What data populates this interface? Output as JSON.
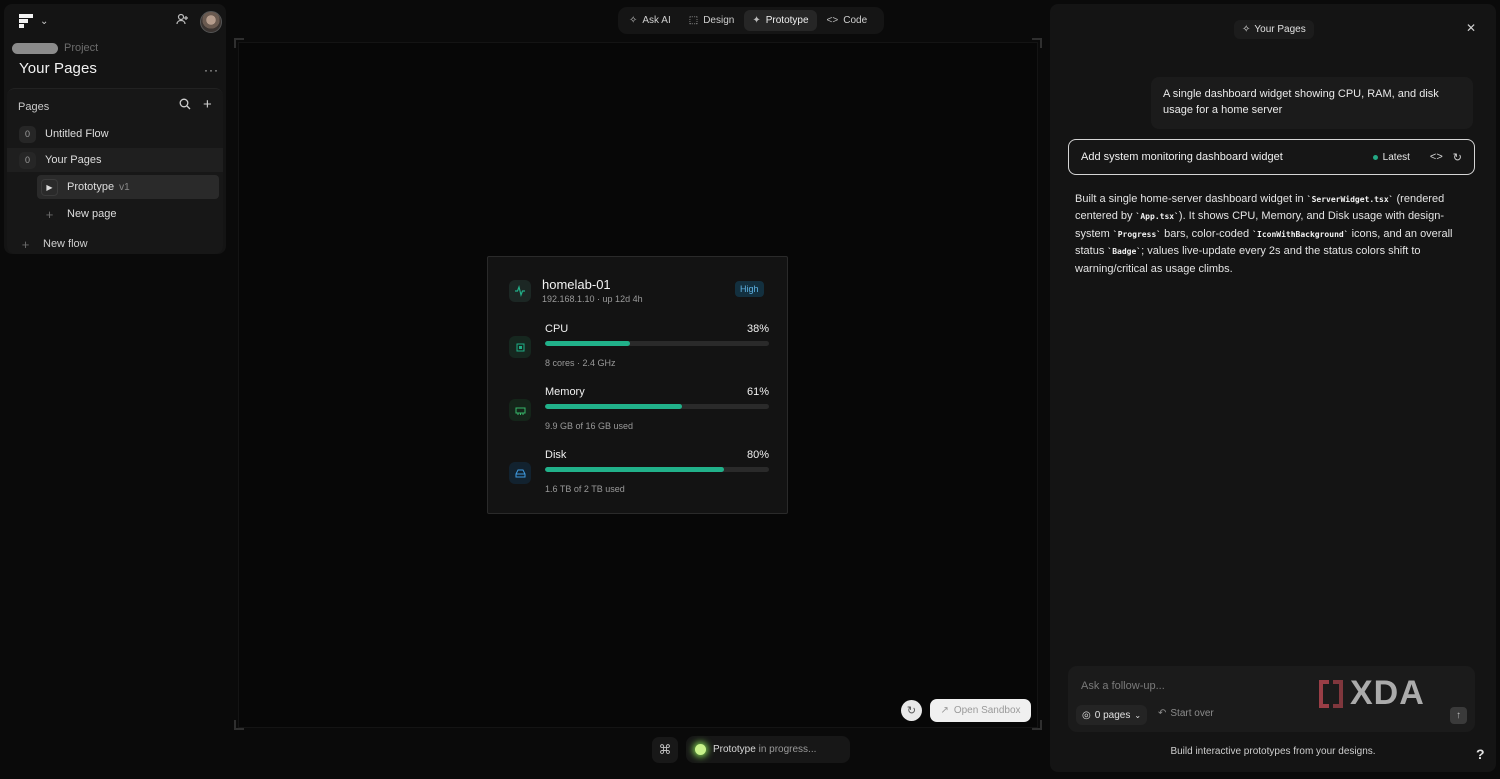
{
  "project": {
    "crumb_label": "Project",
    "title": "Your Pages",
    "more": "···"
  },
  "pages_panel": {
    "heading": "Pages",
    "items": [
      {
        "badge": "0",
        "label": "Untitled Flow"
      },
      {
        "badge": "0",
        "label": "Your Pages"
      }
    ],
    "sub_items": [
      {
        "label": "Prototype",
        "version": "v1"
      },
      {
        "label": "New page"
      }
    ],
    "new_flow": "New flow"
  },
  "modes": [
    {
      "icon": "sparkle-icon",
      "glyph": "✧",
      "label": "Ask AI"
    },
    {
      "icon": "design-icon",
      "glyph": "⬚",
      "label": "Design"
    },
    {
      "icon": "prototype-icon",
      "glyph": "✦",
      "label": "Prototype",
      "active": true
    },
    {
      "icon": "code-icon",
      "glyph": "<>",
      "label": "Code"
    }
  ],
  "widget": {
    "host": "homelab-01",
    "host_sub": "192.168.1.10 · up 12d 4h",
    "status": "High",
    "metrics": [
      {
        "name": "CPU",
        "pct_label": "38%",
        "value": 0.38,
        "detail": "8 cores · 2.4 GHz",
        "icon": "cpu-icon",
        "icon_color": "#1fae86",
        "icon_bg": "#16271f"
      },
      {
        "name": "Memory",
        "pct_label": "61%",
        "value": 0.61,
        "detail": "9.9 GB of 16 GB used",
        "icon": "memory-icon",
        "icon_color": "#37b86a",
        "icon_bg": "#15251a"
      },
      {
        "name": "Disk",
        "pct_label": "80%",
        "value": 0.8,
        "detail": "1.6 TB of 2 TB used",
        "icon": "disk-icon",
        "icon_color": "#3f9be0",
        "icon_bg": "#12222f"
      }
    ]
  },
  "canvas_controls": {
    "open_sandbox": "Open Sandbox",
    "cmd_glyph": "⌘",
    "progress_prefix": "Prototype",
    "progress_suffix": " in progress..."
  },
  "chat": {
    "title": "Your Pages",
    "user_message": "A single dashboard widget showing CPU, RAM, and disk usage for a home server",
    "version_title": "Add system monitoring dashboard widget",
    "version_badge": "Latest",
    "ai_parts": [
      {
        "t": "Built a single home-server dashboard widget in "
      },
      {
        "c": "`ServerWidget.tsx`"
      },
      {
        "t": " (rendered centered by "
      },
      {
        "c": "`App.tsx`"
      },
      {
        "t": "). It shows CPU, Memory, and Disk usage with design-system "
      },
      {
        "c": "`Progress`"
      },
      {
        "t": " bars, color-coded "
      },
      {
        "c": "`IconWithBackground`"
      },
      {
        "t": " icons, and an overall status "
      },
      {
        "c": "`Badge`"
      },
      {
        "t": "; values live-update every 2s and the status colors shift to warning/critical as usage climbs."
      }
    ],
    "composer_placeholder": "Ask a follow-up...",
    "pages_chip": "0 pages",
    "start_over": "Start over",
    "watermark": "XDA",
    "footer": "Build interactive prototypes from your designs.",
    "help": "?"
  },
  "colors": {
    "accent_green": "#21b18a",
    "status_blue": "#5fb3e4"
  }
}
